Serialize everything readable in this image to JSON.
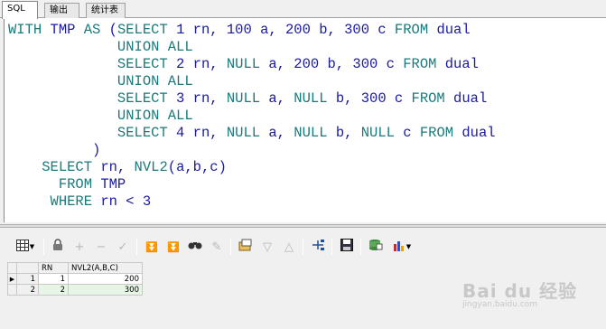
{
  "tabs": [
    {
      "label": "SQL",
      "active": true
    },
    {
      "label": "输出",
      "active": false
    },
    {
      "label": "统计表",
      "active": false
    }
  ],
  "editor": {
    "lines": [
      "WITH TMP AS (SELECT 1 rn, 100 a, 200 b, 300 c FROM dual",
      "             UNION ALL",
      "             SELECT 2 rn, NULL a, 200 b, 300 c FROM dual",
      "             UNION ALL",
      "             SELECT 3 rn, NULL a, NULL b, 300 c FROM dual",
      "             UNION ALL",
      "             SELECT 4 rn, NULL a, NULL b, NULL c FROM dual",
      "          )",
      "    SELECT rn, NVL2(a,b,c)",
      "      FROM TMP",
      "     WHERE rn < 3"
    ]
  },
  "toolbar": {
    "icons": [
      "grid-view-icon",
      "lock-icon",
      "add-row-icon",
      "delete-row-icon",
      "post-check-icon",
      "first-record-icon",
      "last-record-icon",
      "find-icon",
      "clear-icon",
      "export-icon",
      "filter-down-icon",
      "filter-up-icon",
      "link-icon",
      "save-icon",
      "database-export-icon",
      "chart-icon"
    ]
  },
  "grid": {
    "columns": [
      "RN",
      "NVL2(A,B,C)"
    ],
    "rows": [
      {
        "num": "1",
        "rn": "1",
        "val": "200"
      },
      {
        "num": "2",
        "rn": "2",
        "val": "300"
      }
    ]
  },
  "watermark": {
    "main": "Bai du 经验",
    "sub": "jingyan.baidu.com"
  }
}
